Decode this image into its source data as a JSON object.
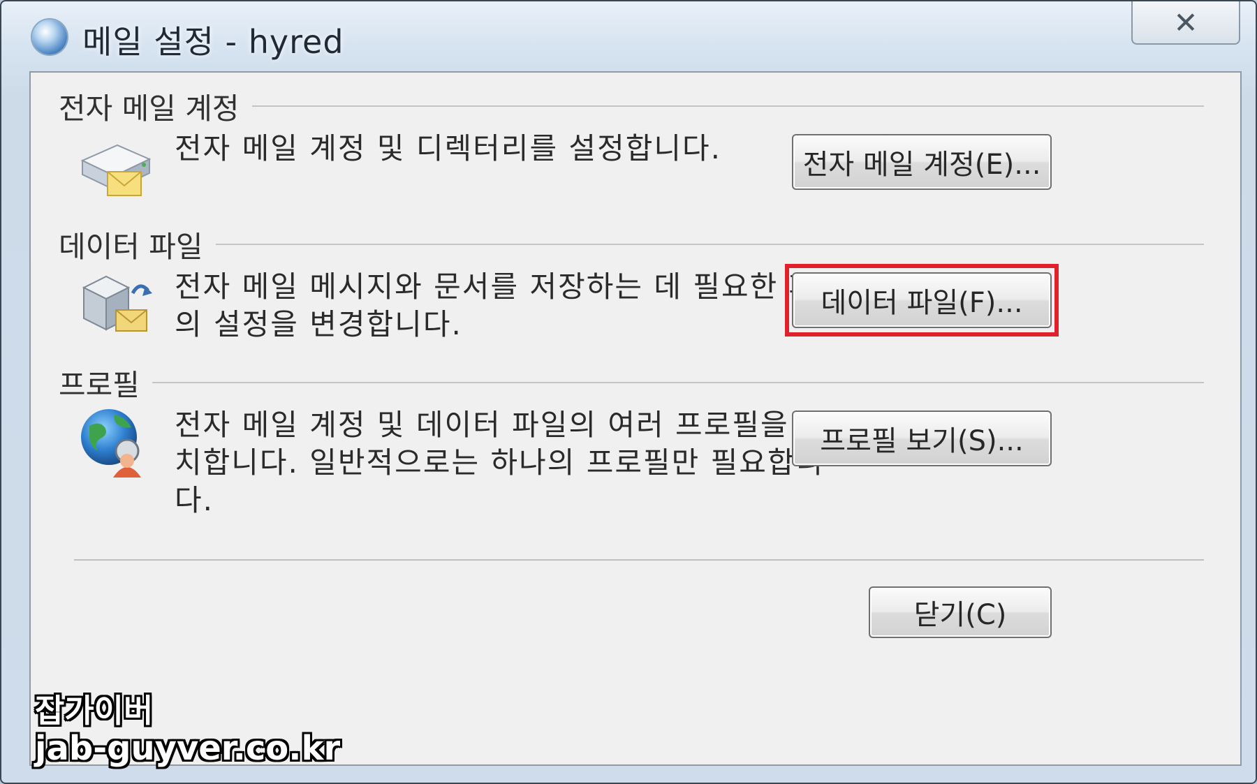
{
  "window": {
    "title": "메일 설정 - hyred",
    "close_glyph": "✕"
  },
  "sections": {
    "accounts": {
      "title": "전자 메일 계정",
      "description": "전자 메일 계정 및 디렉터리를 설정합니다.",
      "button_label": "전자 메일 계정(E)...",
      "icon": "mail-server-icon"
    },
    "data_files": {
      "title": "데이터 파일",
      "description_line1": "전자 메일 메시지와 문서를 저장하는 데 필요한 파일",
      "description_line2": "의 설정을 변경합니다.",
      "button_label": "데이터 파일(F)...",
      "icon": "data-file-icon",
      "highlighted": true
    },
    "profiles": {
      "title": "프로필",
      "description_line1": "전자 메일 계정 및 데이터 파일의 여러 프로필을 설",
      "description_line2": "치합니다. 일반적으로는 하나의 프로필만 필요합니",
      "description_line3": "다.",
      "button_label": "프로필 보기(S)...",
      "icon": "profile-globe-icon"
    }
  },
  "footer": {
    "close_label": "닫기(C)"
  },
  "watermark": {
    "line1": "잡가이버",
    "line2": "jab-guyver.co.kr"
  },
  "colors": {
    "highlight": "#e0202a",
    "dialog_bg": "#f0f0f0",
    "frame": "#cddbe9"
  }
}
